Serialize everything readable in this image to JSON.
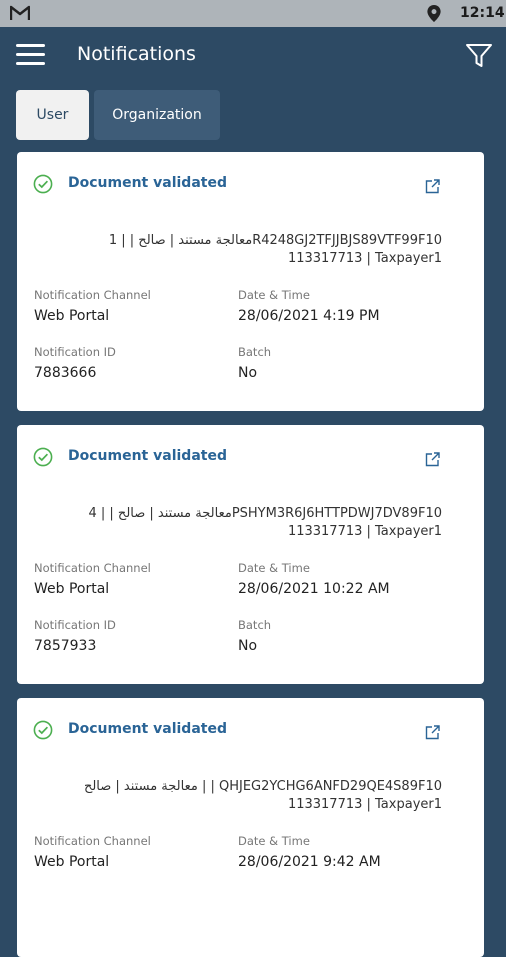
{
  "status_bar": {
    "time": "12:14",
    "icons": [
      "gmail-icon",
      "location-icon"
    ]
  },
  "app_bar": {
    "title": "Notifications",
    "icons": [
      "menu-icon",
      "filter-icon"
    ]
  },
  "tabs": [
    {
      "label": "User",
      "selected": true
    },
    {
      "label": "Organization",
      "selected": false
    }
  ],
  "labels": {
    "channel": "Notification Channel",
    "datetime": "Date & Time",
    "id": "Notification ID",
    "batch": "Batch"
  },
  "notifications": [
    {
      "title": "Document validated",
      "line1": "معالجة مستند | صالح | | 1R4248GJ2TFJJBJS89VTF99F10",
      "line2": "113317713 | Taxpayer1",
      "channel": "Web Portal",
      "datetime": "28/06/2021 4:19 PM",
      "id": "7883666",
      "batch": "No"
    },
    {
      "title": "Document validated",
      "line1": "معالجة مستند | صالح | | 4PSHYM3R6J6HTTPDWJ7DV89F10",
      "line2": "113317713 | Taxpayer1",
      "channel": "Web Portal",
      "datetime": "28/06/2021 10:22 AM",
      "id": "7857933",
      "batch": "No"
    },
    {
      "title": "Document validated",
      "line1": "معالجة مستند | صالح | | QHJEG2YCHG6ANFD29QE4S89F10",
      "line2": "113317713 | Taxpayer1",
      "channel": "Web Portal",
      "datetime": "28/06/2021 9:42 AM",
      "id": "",
      "batch": ""
    }
  ],
  "colors": {
    "background": "#2d4a64",
    "title": "#2a6496",
    "success": "#4caf50"
  }
}
